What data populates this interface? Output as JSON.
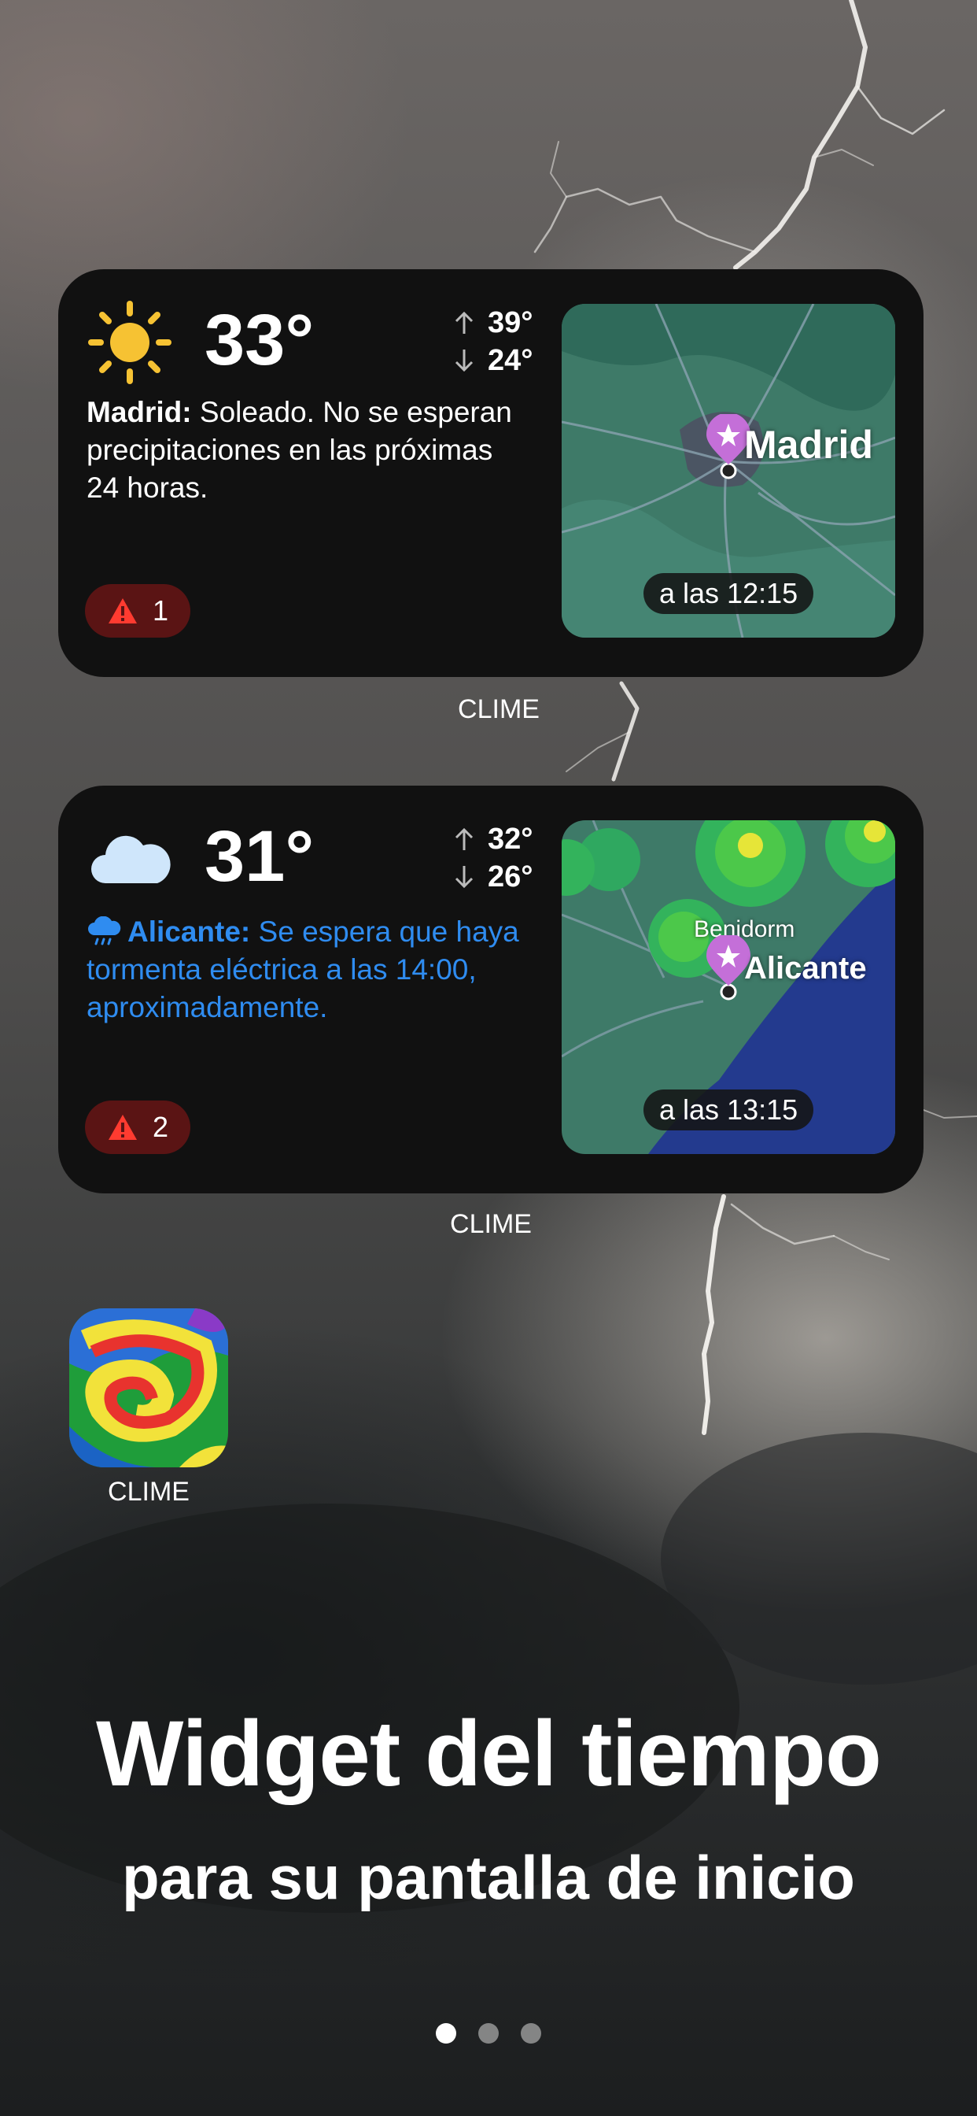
{
  "widgets": [
    {
      "temperature": "33°",
      "high": "39°",
      "low": "24°",
      "city": "Madrid:",
      "description": " Soleado. No se esperan precipitaciones en las próximas 24 horas.",
      "alert_count": "1",
      "map_city": "Madrid",
      "map_time": "a las 12:15",
      "caption": "CLIME",
      "icon": "sun-icon"
    },
    {
      "temperature": "31°",
      "high": "32°",
      "low": "26°",
      "city": "Alicante:",
      "description": " Se espera que haya tormenta eléctrica a las 14:00, aproximadamente.",
      "alert_count": "2",
      "map_city": "Alicante",
      "map_secondary_city": "Benidorm",
      "map_time": "a las 13:15",
      "caption": "CLIME",
      "icon": "cloud-icon"
    }
  ],
  "app": {
    "label": "CLIME"
  },
  "headline": "Widget del tiempo",
  "subline": "para su pantalla de inicio",
  "pager": {
    "pages": 3,
    "active": 1
  },
  "colors": {
    "widget_bg": "#111111",
    "alert_bg": "#5a1414",
    "alert_text_blue": "#2f8cf0",
    "pin": "#c46fd8"
  }
}
